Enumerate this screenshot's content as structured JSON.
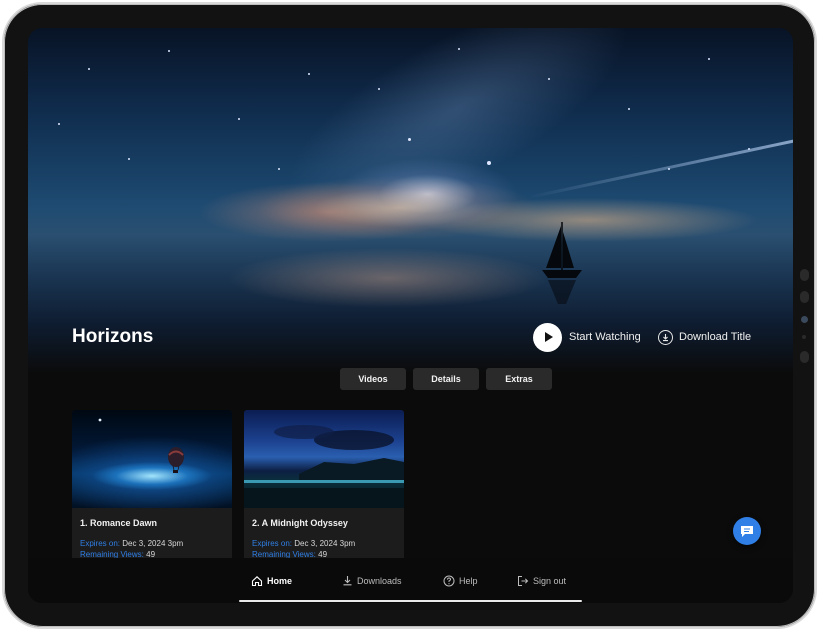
{
  "title": "Horizons",
  "actions": {
    "start_watching": "Start Watching",
    "download_title": "Download Title"
  },
  "tabs": [
    "Videos",
    "Details",
    "Extras"
  ],
  "videos": [
    {
      "title": "1. Romance Dawn",
      "expires_label": "Expires on:",
      "expires_value": "Dec 3, 2024 3pm",
      "remaining_label": "Remaining Views:",
      "remaining_value": "49"
    },
    {
      "title": "2. A Midnight Odyssey",
      "expires_label": "Expires on:",
      "expires_value": "Dec 3, 2024 3pm",
      "remaining_label": "Remaining Views:",
      "remaining_value": "49"
    }
  ],
  "nav": {
    "home": "Home",
    "downloads": "Downloads",
    "help": "Help",
    "sign_out": "Sign out",
    "active": "home"
  },
  "icons": {
    "play": "play-icon",
    "download": "download-icon",
    "chat": "chat-icon",
    "home": "home-icon",
    "downloads": "download-arrow-icon",
    "help": "help-icon",
    "sign_out": "sign-out-icon"
  },
  "colors": {
    "accent": "#2f7fe6",
    "background": "#0b0b0b",
    "tab_bg": "#2a2a2a"
  }
}
